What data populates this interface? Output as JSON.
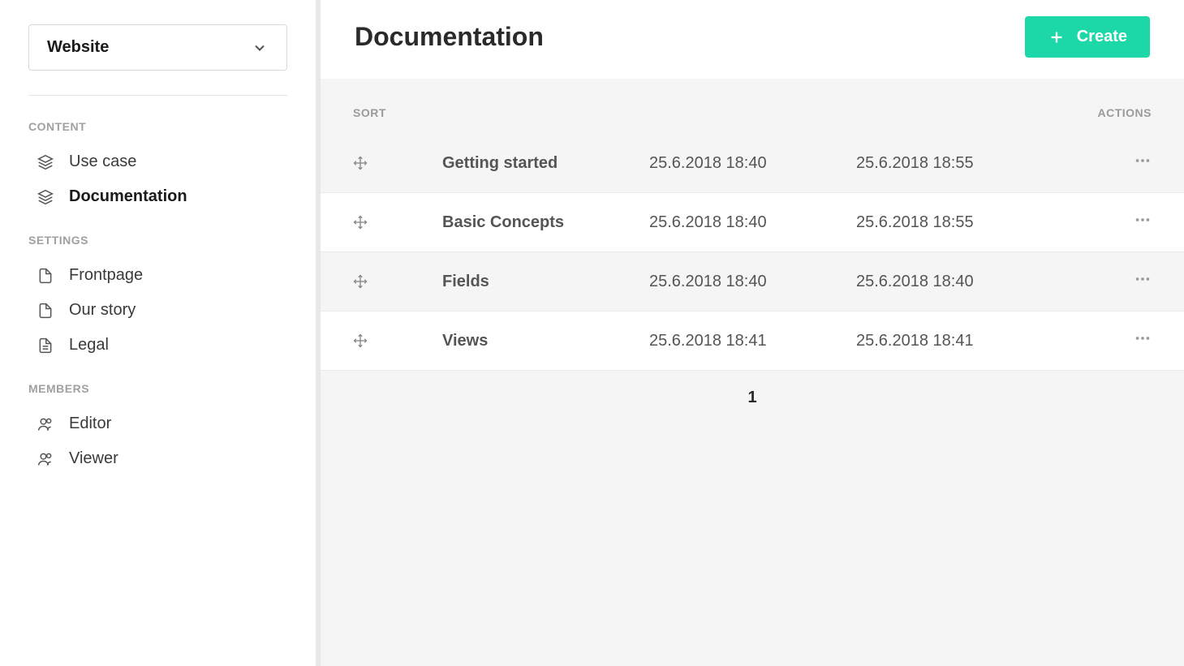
{
  "sidebar": {
    "project_select": "Website",
    "sections": {
      "content": {
        "label": "CONTENT",
        "items": [
          {
            "label": "Use case",
            "icon": "layers-icon",
            "active": false
          },
          {
            "label": "Documentation",
            "icon": "layers-icon",
            "active": true
          }
        ]
      },
      "settings": {
        "label": "SETTINGS",
        "items": [
          {
            "label": "Frontpage",
            "icon": "page-icon"
          },
          {
            "label": "Our story",
            "icon": "page-icon"
          },
          {
            "label": "Legal",
            "icon": "doc-icon"
          }
        ]
      },
      "members": {
        "label": "MEMBERS",
        "items": [
          {
            "label": "Editor",
            "icon": "users-icon"
          },
          {
            "label": "Viewer",
            "icon": "users-icon"
          }
        ]
      }
    }
  },
  "header": {
    "title": "Documentation",
    "create_label": "Create"
  },
  "table": {
    "columns": {
      "sort": "SORT",
      "actions": "ACTIONS"
    },
    "rows": [
      {
        "title": "Getting started",
        "created": "25.6.2018 18:40",
        "updated": "25.6.2018 18:55"
      },
      {
        "title": "Basic Concepts",
        "created": "25.6.2018 18:40",
        "updated": "25.6.2018 18:55"
      },
      {
        "title": "Fields",
        "created": "25.6.2018 18:40",
        "updated": "25.6.2018 18:40"
      },
      {
        "title": "Views",
        "created": "25.6.2018 18:41",
        "updated": "25.6.2018 18:41"
      }
    ]
  },
  "pagination": {
    "page": "1"
  }
}
